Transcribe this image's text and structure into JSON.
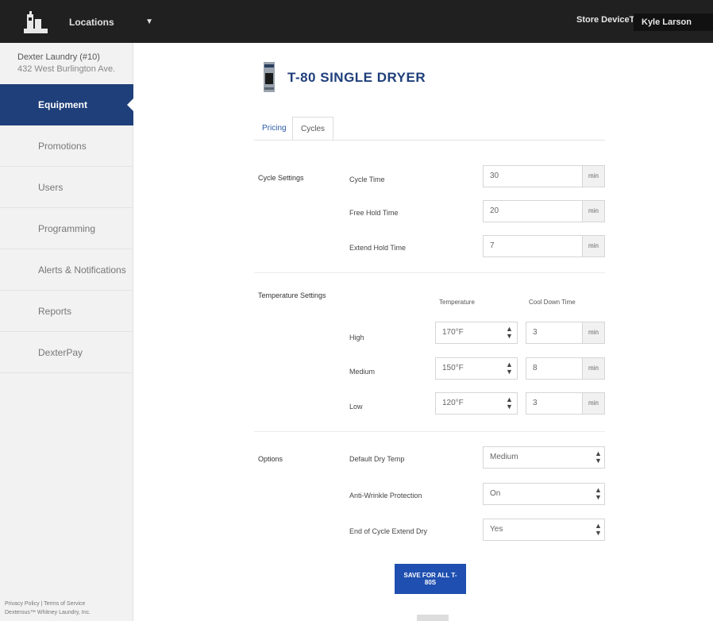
{
  "topbar": {
    "location_label": "Locations",
    "link_label": "Store DeviceTag",
    "user_label": "Kyle Larson"
  },
  "sidebar": {
    "store_name": "Dexter Laundry (#10)",
    "store_address": "432 West Burlington Ave.",
    "items": [
      {
        "label": "Equipment",
        "active": true
      },
      {
        "label": "Promotions",
        "active": false
      },
      {
        "label": "Users",
        "active": false
      },
      {
        "label": "Programming",
        "active": false
      },
      {
        "label": "Alerts & Notifications",
        "active": false
      },
      {
        "label": "Reports",
        "active": false
      },
      {
        "label": "DexterPay",
        "active": false
      }
    ],
    "footer_line1": "Privacy Policy | Terms of Service",
    "footer_line2": "Dexterous™ Whitney Laundry, Inc."
  },
  "page": {
    "title": "T-80 SINGLE DRYER",
    "tabs": [
      {
        "label": "Pricing",
        "active": false
      },
      {
        "label": "Cycles",
        "active": true
      }
    ]
  },
  "cycle_settings": {
    "label": "Cycle Settings",
    "fields": [
      {
        "label": "Cycle Time",
        "value": "30",
        "unit": "min"
      },
      {
        "label": "Free Hold Time",
        "value": "20",
        "unit": "min"
      },
      {
        "label": "Extend Hold Time",
        "value": "7",
        "unit": "min"
      }
    ]
  },
  "temperature_settings": {
    "label": "Temperature Settings",
    "col_temp": "Temperature",
    "col_cool": "Cool Down Time",
    "rows": [
      {
        "label": "High",
        "temp": "170°F",
        "cool": "3",
        "unit": "min"
      },
      {
        "label": "Medium",
        "temp": "150°F",
        "cool": "8",
        "unit": "min"
      },
      {
        "label": "Low",
        "temp": "120°F",
        "cool": "3",
        "unit": "min"
      }
    ]
  },
  "options": {
    "label": "Options",
    "fields": [
      {
        "label": "Default Dry Temp",
        "value": "Medium"
      },
      {
        "label": "Anti-Wrinkle Protection",
        "value": "On"
      },
      {
        "label": "End of Cycle Extend Dry",
        "value": "Yes"
      }
    ]
  },
  "save_label": "SAVE FOR ALL T-80S",
  "colors": {
    "brand_navy": "#1f3f7a",
    "button_blue": "#1f4fb0",
    "topbar": "#202020"
  }
}
